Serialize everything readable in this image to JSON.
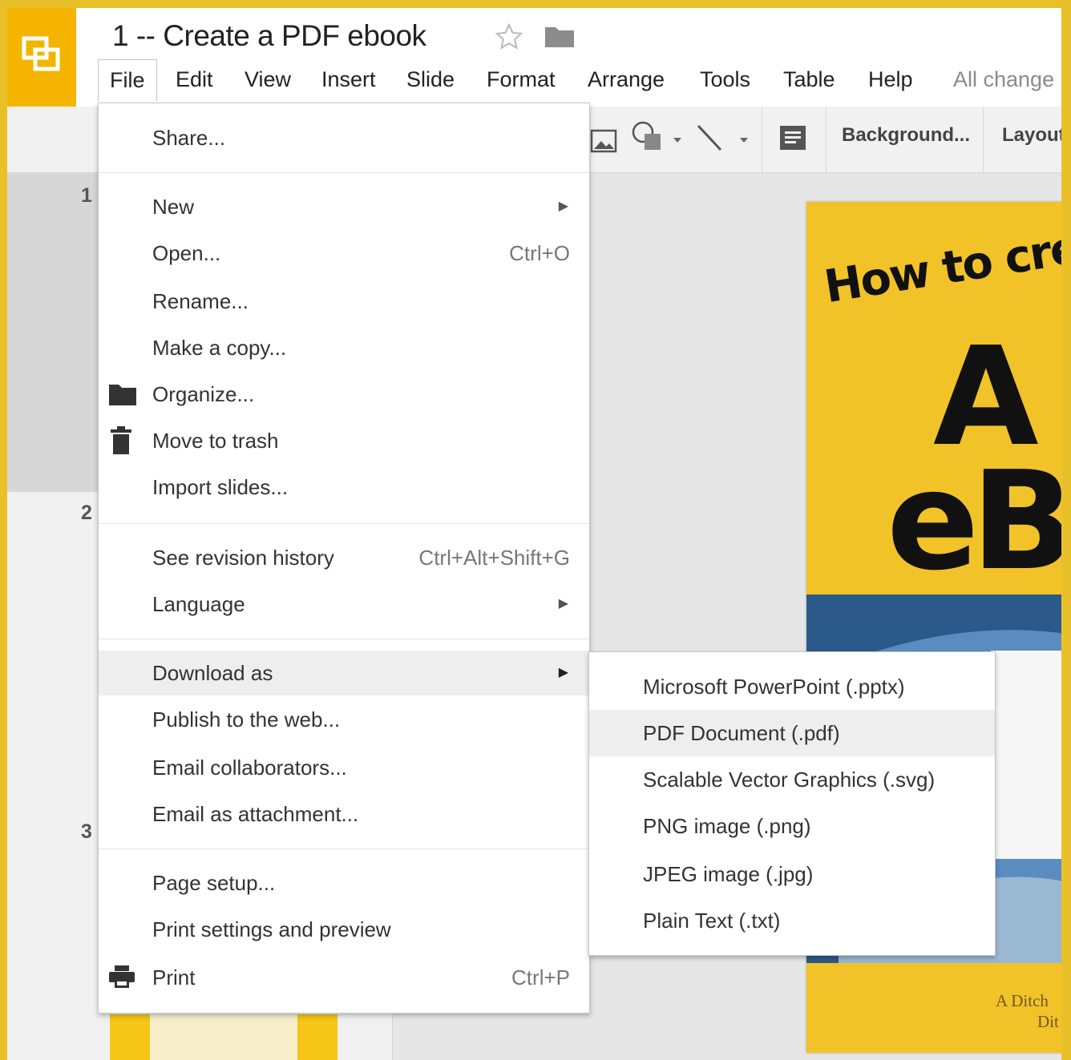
{
  "header": {
    "title": "1 -- Create a PDF ebook",
    "status": "All change",
    "menus": [
      "File",
      "Edit",
      "View",
      "Insert",
      "Slide",
      "Format",
      "Arrange",
      "Tools",
      "Table",
      "Help"
    ],
    "active_menu": "File"
  },
  "toolbar": {
    "background_label": "Background...",
    "layout_label": "Layout"
  },
  "filmstrip": {
    "slide_numbers": [
      "1",
      "2",
      "3"
    ]
  },
  "file_menu": {
    "items": [
      {
        "label": "Share..."
      },
      {
        "label": "New"
      },
      {
        "label": "Open...",
        "shortcut": "Ctrl+O"
      },
      {
        "label": "Rename..."
      },
      {
        "label": "Make a copy..."
      },
      {
        "label": "Organize...",
        "icon": "folder-icon"
      },
      {
        "label": "Move to trash",
        "icon": "trash-icon"
      },
      {
        "label": "Import slides..."
      },
      {
        "label": "See revision history",
        "shortcut": "Ctrl+Alt+Shift+G"
      },
      {
        "label": "Language"
      },
      {
        "label": "Download as"
      },
      {
        "label": "Publish to the web..."
      },
      {
        "label": "Email collaborators..."
      },
      {
        "label": "Email as attachment..."
      },
      {
        "label": "Page setup..."
      },
      {
        "label": "Print settings and preview"
      },
      {
        "label": "Print",
        "shortcut": "Ctrl+P",
        "icon": "printer-icon"
      }
    ]
  },
  "download_submenu": {
    "items": [
      {
        "label": "Microsoft PowerPoint (.pptx)"
      },
      {
        "label": "PDF Document (.pdf)"
      },
      {
        "label": "Scalable Vector Graphics (.svg)"
      },
      {
        "label": "PNG image (.png)"
      },
      {
        "label": "JPEG image (.jpg)"
      },
      {
        "label": "Plain Text (.txt)"
      }
    ],
    "highlighted": "PDF Document (.pdf)"
  },
  "slide": {
    "heading": "How to crea",
    "big_letter": "A",
    "big_word": "eB",
    "credit_line1": "A Ditch",
    "credit_line2": "Dit"
  },
  "colors": {
    "accent_yellow": "#f4b400",
    "background": "#e8c12a"
  }
}
